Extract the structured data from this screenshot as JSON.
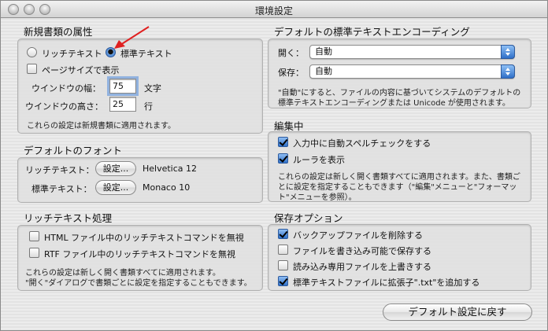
{
  "window": {
    "title": "環境設定"
  },
  "new_doc": {
    "title": "新規書類の属性",
    "radio_rich": "リッチテキスト",
    "radio_plain": "標準テキスト",
    "page_size_label": "ページサイズで表示",
    "width_label": "ウインドウの幅：",
    "width_value": "75",
    "width_unit": "文字",
    "height_label": "ウインドウの高さ：",
    "height_value": "25",
    "height_unit": "行",
    "note": "これらの設定は新規書類に適用されます。"
  },
  "fonts": {
    "title": "デフォルトのフォント",
    "rich_label": "リッチテキスト：",
    "rich_button": "設定...",
    "rich_font": "Helvetica 12",
    "plain_label": "標準テキスト：",
    "plain_button": "設定...",
    "plain_font": "Monaco 10"
  },
  "rich_processing": {
    "title": "リッチテキスト処理",
    "html_label": "HTML ファイル中のリッチテキストコマンドを無視",
    "rtf_label": "RTF ファイル中のリッチテキストコマンドを無視",
    "note1": "これらの設定は新しく開く書類すべてに適用されます。",
    "note2": "\"開く\"ダイアログで書類ごとに設定を指定することもできます。"
  },
  "encoding": {
    "title": "デフォルトの標準テキストエンコーディング",
    "open_label": "開く：",
    "open_value": "自動",
    "save_label": "保存：",
    "save_value": "自動",
    "note1": "\"自動\"にすると、ファイルの内容に基づいてシステムのデフォルトの",
    "note2": "標準テキストエンコーディングまたは Unicode が使用されます。"
  },
  "editing": {
    "title": "編集中",
    "spell_label": "入力中に自動スペルチェックをする",
    "ruler_label": "ルーラを表示",
    "note1": "これらの設定は新しく開く書類すべてに適用されます。また、書類ご",
    "note2": "とに設定を指定することもできます（\"編集\"メニューと\"フォーマッ",
    "note3": "ト\"メニューを参照）。"
  },
  "save_options": {
    "title": "保存オプション",
    "backup_label": "バックアップファイルを削除する",
    "writable_label": "ファイルを書き込み可能で保存する",
    "overwrite_label": "読み込み専用ファイルを上書きする",
    "extension_label": "標準テキストファイルに拡張子\".txt\"を追加する"
  },
  "reset_button": "デフォルト設定に戻す",
  "colors": {
    "accent": "#2f6fc8",
    "annotation_arrow": "#e02020"
  }
}
